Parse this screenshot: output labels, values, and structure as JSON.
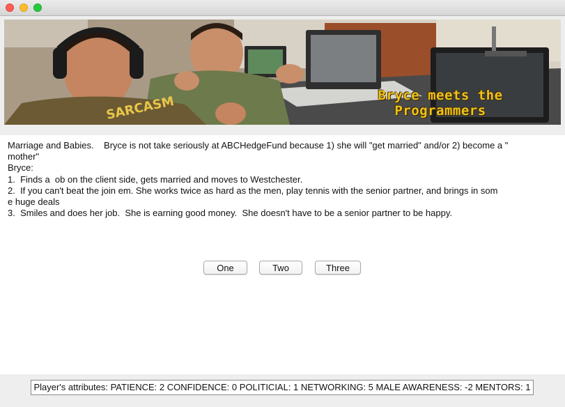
{
  "banner": {
    "title_line1": "Bryce meets the",
    "title_line2": "Programmers",
    "shirt_text": "SARCASM",
    "accent_color": "#f2c21a"
  },
  "story": {
    "lines": [
      "Marriage and Babies.    Bryce is not take seriously at ABCHedgeFund because 1) she will \"get married\" and/or 2) become a \"",
      "mother\"",
      "Bryce:",
      "1.  Finds a  ob on the client side, gets married and moves to Westchester.",
      "2.  If you can't beat the join em. She works twice as hard as the men, play tennis with the senior partner, and brings in som",
      "e huge deals",
      "3.  Smiles and does her job.  She is earning good money.  She doesn't have to be a senior partner to be happy."
    ]
  },
  "choices": {
    "one": "One",
    "two": "Two",
    "three": "Three"
  },
  "status": {
    "attributes": "Player's attributes: PATIENCE: 2 CONFIDENCE: 0 POLITICIAL: 1 NETWORKING: 5 MALE AWARENESS: -2 MENTORS: 1"
  }
}
